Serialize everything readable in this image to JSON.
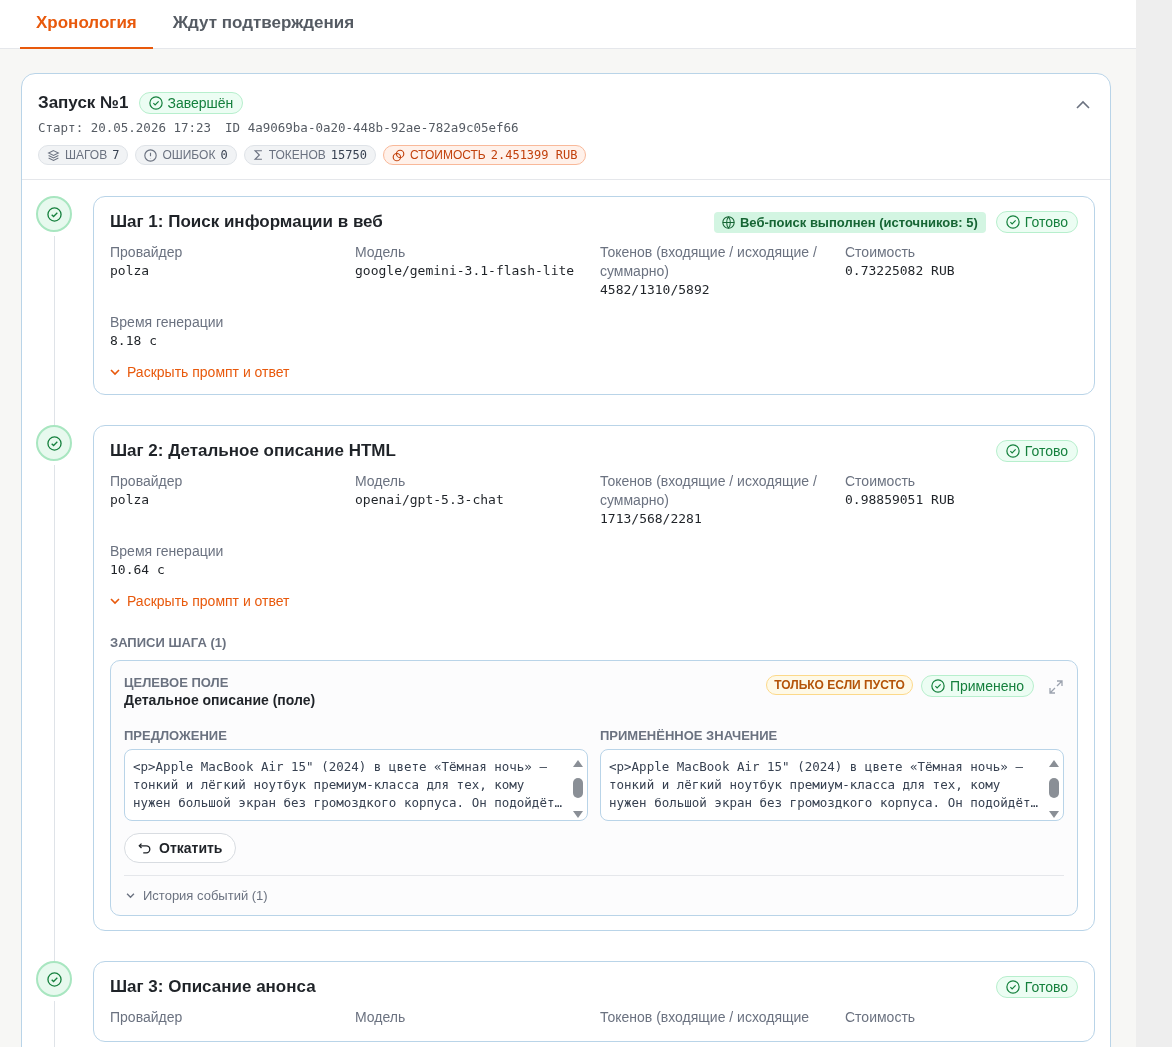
{
  "tabs": [
    {
      "label": "Хронология",
      "selected": true
    },
    {
      "label": "Ждут подтверждения",
      "selected": false
    }
  ],
  "run": {
    "title": "Запуск №1",
    "status": {
      "kind": "success",
      "label": "Завершён"
    },
    "start": "Старт: 20.05.2026 17:23",
    "id": "ID 4a9069ba-0a20-448b-92ae-782a9c05ef66",
    "expanded": true,
    "stats": [
      {
        "kind": "steps",
        "label": "ШАГОВ",
        "value": "7"
      },
      {
        "kind": "errors",
        "label": "ОШИБОК",
        "value": "0"
      },
      {
        "kind": "tokens",
        "label": "ТОКЕНОВ",
        "value": "15750"
      },
      {
        "kind": "cost",
        "label": "СТОИМОСТЬ",
        "value": "2.451399 RUB"
      }
    ]
  },
  "steps": [
    {
      "title": "Шаг 1: Поиск информации в веб",
      "done": true,
      "badges": [
        {
          "kind": "web",
          "label": "Веб-поиск выполнен (источников: 5)"
        }
      ],
      "status": {
        "kind": "success",
        "label": "Готово"
      },
      "fields": [
        {
          "label": "Провайдер",
          "value": "polza"
        },
        {
          "label": "Модель",
          "value": "google/gemini-3.1-flash-lite"
        },
        {
          "label": "Токенов (входящие / исходящие / суммарно)",
          "value": "4582/1310/5892"
        },
        {
          "label": "Стоимость",
          "value": "0.73225082 RUB"
        },
        {
          "label": "Время генерации",
          "value": "8.18 с"
        }
      ],
      "expand_link": "Раскрыть промпт и ответ"
    },
    {
      "title": "Шаг 2: Детальное описание HTML",
      "done": true,
      "status": {
        "kind": "success",
        "label": "Готово"
      },
      "fields": [
        {
          "label": "Провайдер",
          "value": "polza"
        },
        {
          "label": "Модель",
          "value": "openai/gpt-5.3-chat"
        },
        {
          "label": "Токенов (входящие / исходящие / суммарно)",
          "value": "1713/568/2281"
        },
        {
          "label": "Стоимость",
          "value": "0.98859051 RUB"
        },
        {
          "label": "Время генерации",
          "value": "10.64 с"
        }
      ],
      "expand_link": "Раскрыть промпт и ответ",
      "records": {
        "title": "ЗАПИСИ ШАГА (1)",
        "items": [
          {
            "target_label": "ЦЕЛЕВОЕ ПОЛЕ",
            "target_value": "Детальное описание (поле)",
            "mode": "ТОЛЬКО ЕСЛИ ПУСТО",
            "status": {
              "kind": "success",
              "label": "Применено"
            },
            "proposal_label": "ПРЕДЛОЖЕНИЕ",
            "proposal_text": "<p>Apple MacBook Air 15\" (2024) в цвете «Тёмная ночь» —\nтонкий и лёгкий ноутбук премиум-класса для тех, кому\nнужен большой экран без громоздкого корпуса. Он подойдёт…",
            "applied_label": "ПРИМЕНЁННОЕ ЗНАЧЕНИЕ",
            "applied_text": "<p>Apple MacBook Air 15\" (2024) в цвете «Тёмная ночь» —\nтонкий и лёгкий ноутбук премиум-класса для тех, кому\nнужен большой экран без громоздкого корпуса. Он подойдёт…",
            "rollback": "Откатить",
            "history": "История событий (1)"
          }
        ]
      }
    },
    {
      "title": "Шаг 3: Описание анонса",
      "done": true,
      "status": {
        "kind": "success",
        "label": "Готово"
      },
      "fields": [
        {
          "label": "Провайдер"
        },
        {
          "label": "Модель"
        },
        {
          "label": "Токенов (входящие / исходящие"
        },
        {
          "label": "Стоимость"
        }
      ]
    }
  ]
}
